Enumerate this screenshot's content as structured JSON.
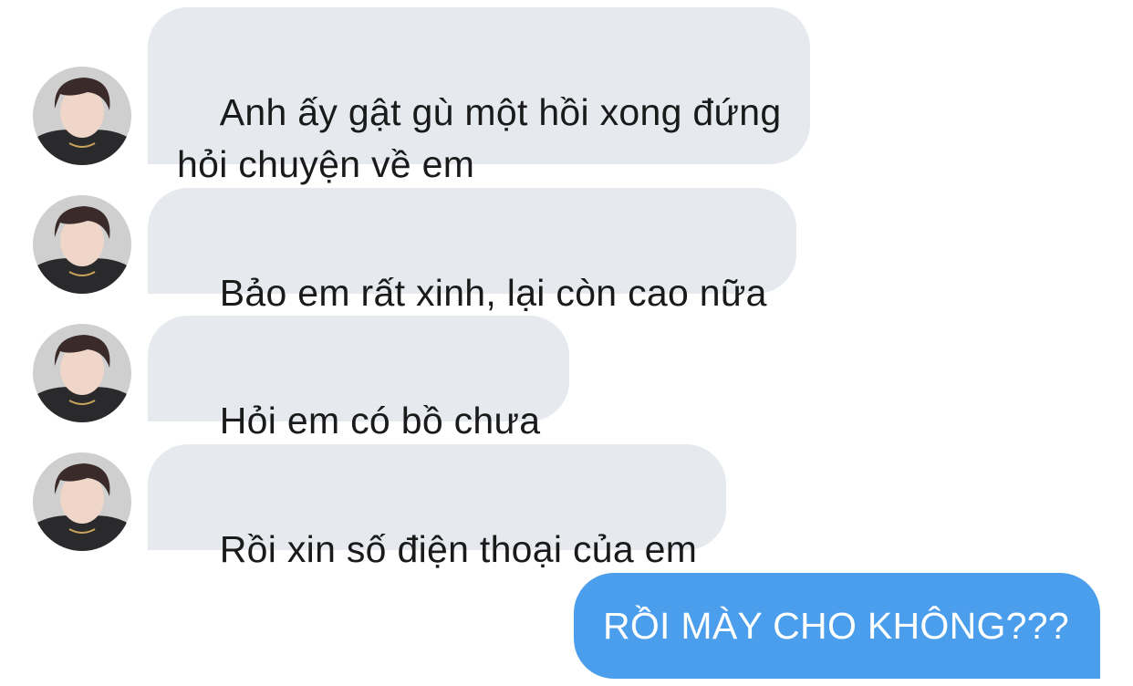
{
  "conversation": {
    "incoming": [
      {
        "text": "Anh ấy gật gù một hồi xong đứng\nhỏi chuyện về em"
      },
      {
        "text": "Bảo em rất xinh, lại còn cao nữa"
      },
      {
        "text": "Hỏi em có bồ chưa"
      },
      {
        "text": "Rồi xin số điện thoại của em"
      }
    ],
    "outgoing": [
      {
        "text": "RỒI MÀY CHO KHÔNG???"
      }
    ]
  },
  "colors": {
    "incoming_bubble": "#e6e9ee",
    "outgoing_bubble": "#4a9eeb",
    "incoming_text": "#1a1a1a",
    "outgoing_text": "#ffffff"
  },
  "icons": {
    "avatar": "avatar-icon"
  }
}
